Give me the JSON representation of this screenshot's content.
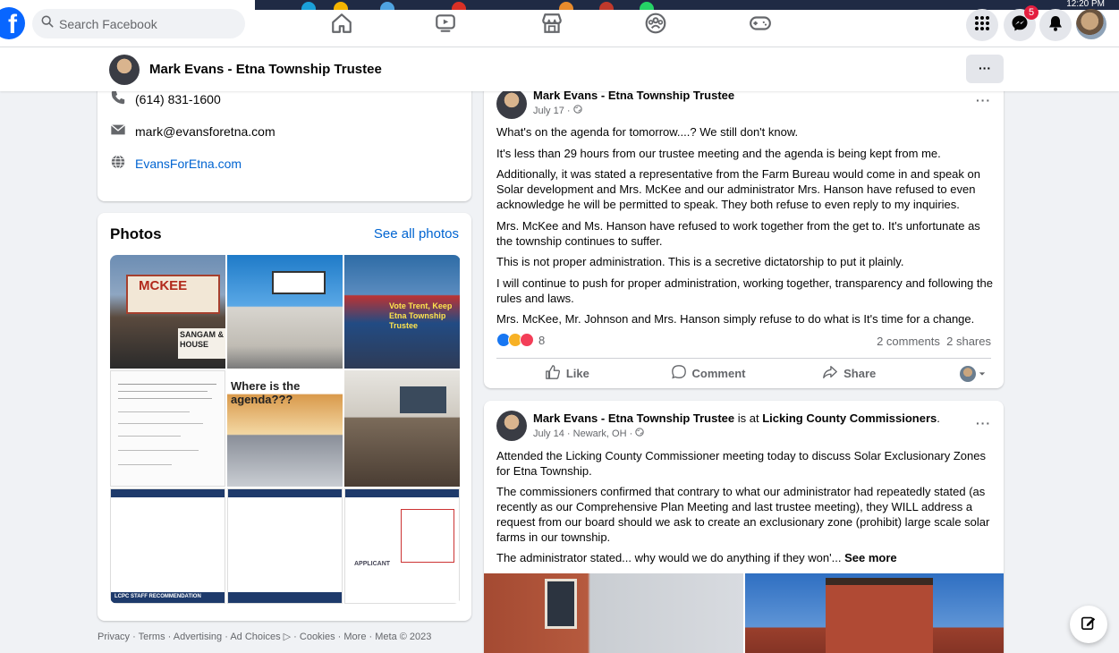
{
  "topnav": {
    "logo": "f",
    "search_placeholder": "Search Facebook",
    "notification_count": "5",
    "clock": "12:20 PM"
  },
  "page_header": {
    "name": "Mark Evans - Etna Township Trustee",
    "more": "···"
  },
  "contact": {
    "phone": "(614) 831-1600",
    "email": "mark@evansforetna.com",
    "website": "EvansForEtna.com"
  },
  "photos": {
    "title": "Photos",
    "see_all": "See all photos",
    "sign1": "MCKEE",
    "sign2": "SANGAM & HOUSE",
    "sign3": "Vote Trent, Keep Etna Township Trustee",
    "agenda_label": "Where is the agenda???",
    "applicant": "APPLICANT",
    "staff_rec": "LCPC STAFF RECOMMENDATION"
  },
  "post1": {
    "author": "Mark Evans - Etna Township Trustee",
    "date": "July 17 ·",
    "more": "···",
    "paragraphs": [
      "What's on the agenda for tomorrow....? We still don't know.",
      "It's less than 29 hours from our trustee meeting and the agenda is being kept from me.",
      "Additionally, it was stated a representative from the Farm Bureau would come in and speak on Solar development and Mrs. McKee and our administrator Mrs. Hanson have refused to even acknowledge he will be permitted to speak. They both refuse to even reply to my inquiries.",
      "Mrs. McKee and Ms. Hanson have refused to work together from the get to. It's unfortunate as the township continues to suffer.",
      "This is not proper administration. This is a secretive dictatorship to put it plainly.",
      "I will continue to push for proper administration, working together, transparency and following the rules and laws.",
      "Mrs. McKee, Mr. Johnson and Mrs. Hanson simply refuse to do what is It's time for a change."
    ],
    "reaction_count": "8",
    "comments": "2 comments",
    "shares": "2 shares",
    "like": "Like",
    "comment": "Comment",
    "share": "Share"
  },
  "post2": {
    "author": "Mark Evans - Etna Township Trustee",
    "is_at": " is at ",
    "place": "Licking County Commissioners",
    "period": ".",
    "date": "July 14 · Newark, OH ·",
    "more": "···",
    "paragraphs": [
      "Attended the Licking County Commissioner meeting today to discuss Solar Exclusionary Zones for Etna Township.",
      "The commissioners confirmed that contrary to what our administrator had repeatedly stated (as recently as our Comprehensive Plan Meeting and last trustee meeting), they WILL address a request from our board should we ask to create an exclusionary zone (prohibit) large scale solar farms in our township."
    ],
    "truncated": "The administrator stated... why would we do anything if they won'...",
    "see_more": "See more"
  },
  "footer": "Privacy · Terms · Advertising · Ad Choices ▷ · Cookies · More · Meta © 2023",
  "colors": {
    "brand": "#0866ff",
    "link": "#0064d1",
    "background": "#f0f2f5"
  }
}
